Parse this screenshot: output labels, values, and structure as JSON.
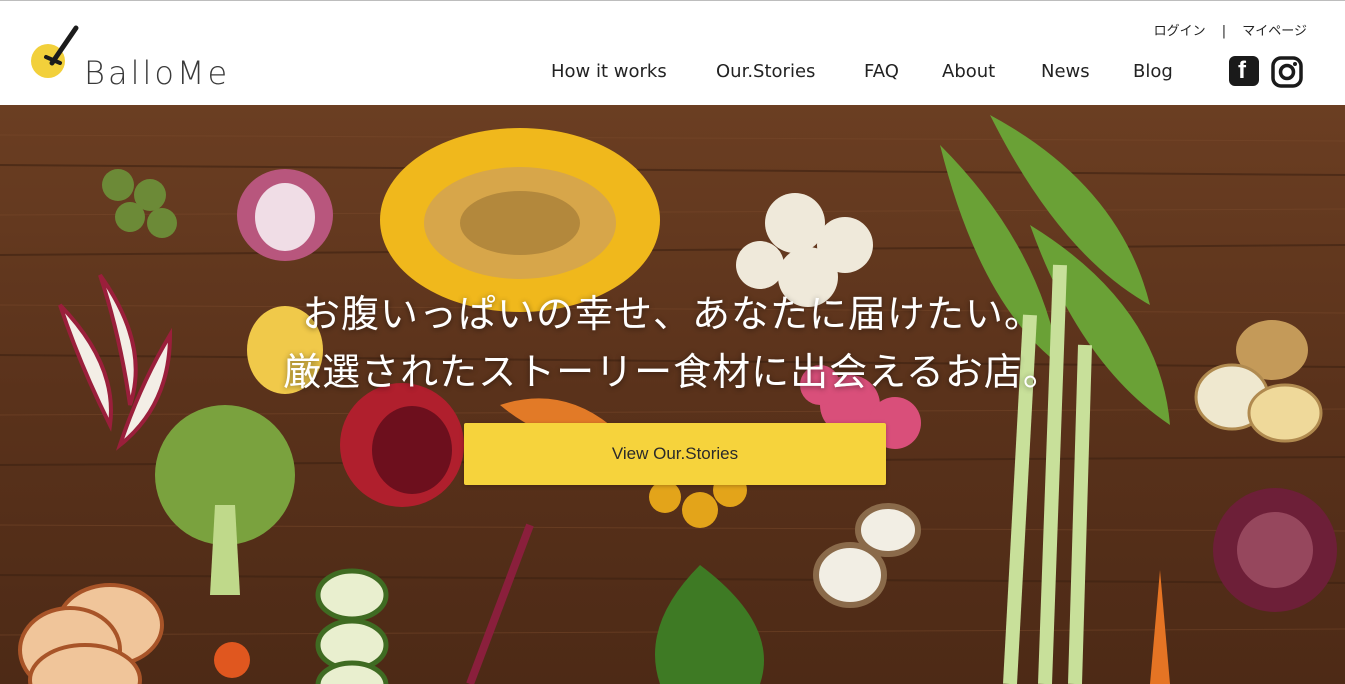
{
  "brand": {
    "name": "BalloMe",
    "accent_color": "#f6d33c"
  },
  "utility_nav": {
    "login": "ログイン",
    "separator": "|",
    "mypage": "マイページ"
  },
  "main_nav": [
    {
      "label": "How it works"
    },
    {
      "label": "Our.Stories"
    },
    {
      "label": "FAQ"
    },
    {
      "label": "About"
    },
    {
      "label": "News"
    },
    {
      "label": "Blog"
    }
  ],
  "social": {
    "facebook_icon": "facebook-icon",
    "instagram_icon": "instagram-icon",
    "facebook_glyph": "f"
  },
  "hero": {
    "headline_line1": "お腹いっぱいの幸せ、あなたに届けたい。",
    "headline_line2": "厳選されたストーリー食材に出会えるお店。",
    "cta_label": "View Our.Stories",
    "background": "wooden-table-with-vegetables"
  }
}
